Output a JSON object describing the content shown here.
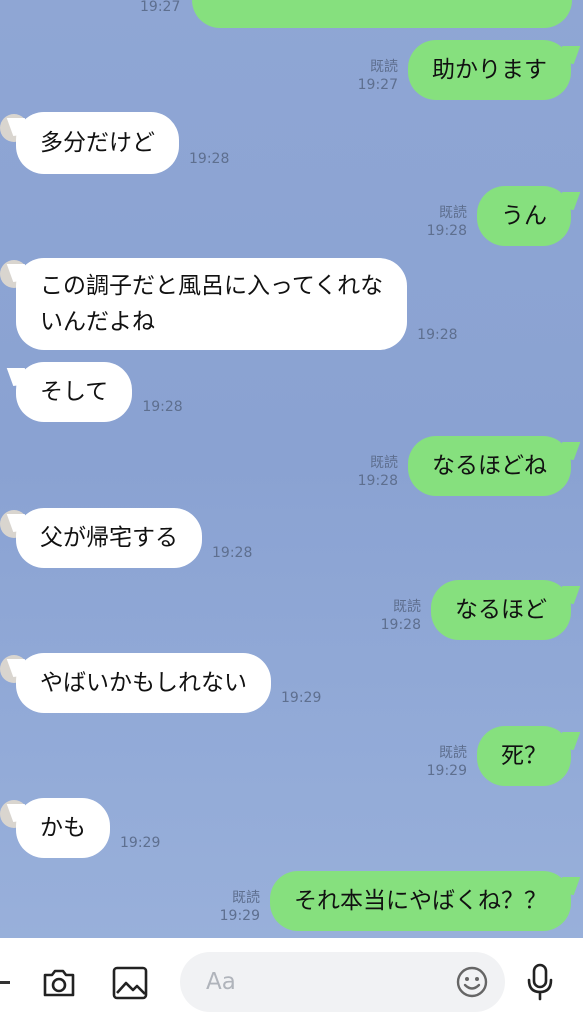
{
  "messages": [
    {
      "side": "out",
      "text": "",
      "read": "",
      "time": "19:27"
    },
    {
      "side": "out",
      "text": "助かります",
      "read": "既読",
      "time": "19:27"
    },
    {
      "side": "in",
      "text": "多分だけど",
      "time": "19:28"
    },
    {
      "side": "out",
      "text": "うん",
      "read": "既読",
      "time": "19:28"
    },
    {
      "side": "in",
      "text": "この調子だと風呂に入ってくれないんだよね",
      "line1": "この調子だと風呂に入ってくれな",
      "line2": "いんだよね",
      "time": "19:28"
    },
    {
      "side": "in",
      "text": "そして",
      "time": "19:28"
    },
    {
      "side": "out",
      "text": "なるほどね",
      "read": "既読",
      "time": "19:28"
    },
    {
      "side": "in",
      "text": "父が帰宅する",
      "time": "19:28"
    },
    {
      "side": "out",
      "text": "なるほど",
      "read": "既読",
      "time": "19:28"
    },
    {
      "side": "in",
      "text": "やばいかもしれない",
      "time": "19:29"
    },
    {
      "side": "out",
      "text": "死？",
      "read": "既読",
      "time": "19:29"
    },
    {
      "side": "in",
      "text": "かも",
      "time": "19:29"
    },
    {
      "side": "out",
      "text": "それ本当にやばくね？？",
      "read": "既読",
      "time": "19:29"
    }
  ],
  "input": {
    "placeholder": "Aa"
  },
  "colors": {
    "outgoing": "#86e07e",
    "incoming": "#ffffff",
    "background": "#8ea6d4"
  },
  "icons": [
    "more-icon",
    "camera-icon",
    "image-icon",
    "emoji-icon",
    "microphone-icon"
  ]
}
